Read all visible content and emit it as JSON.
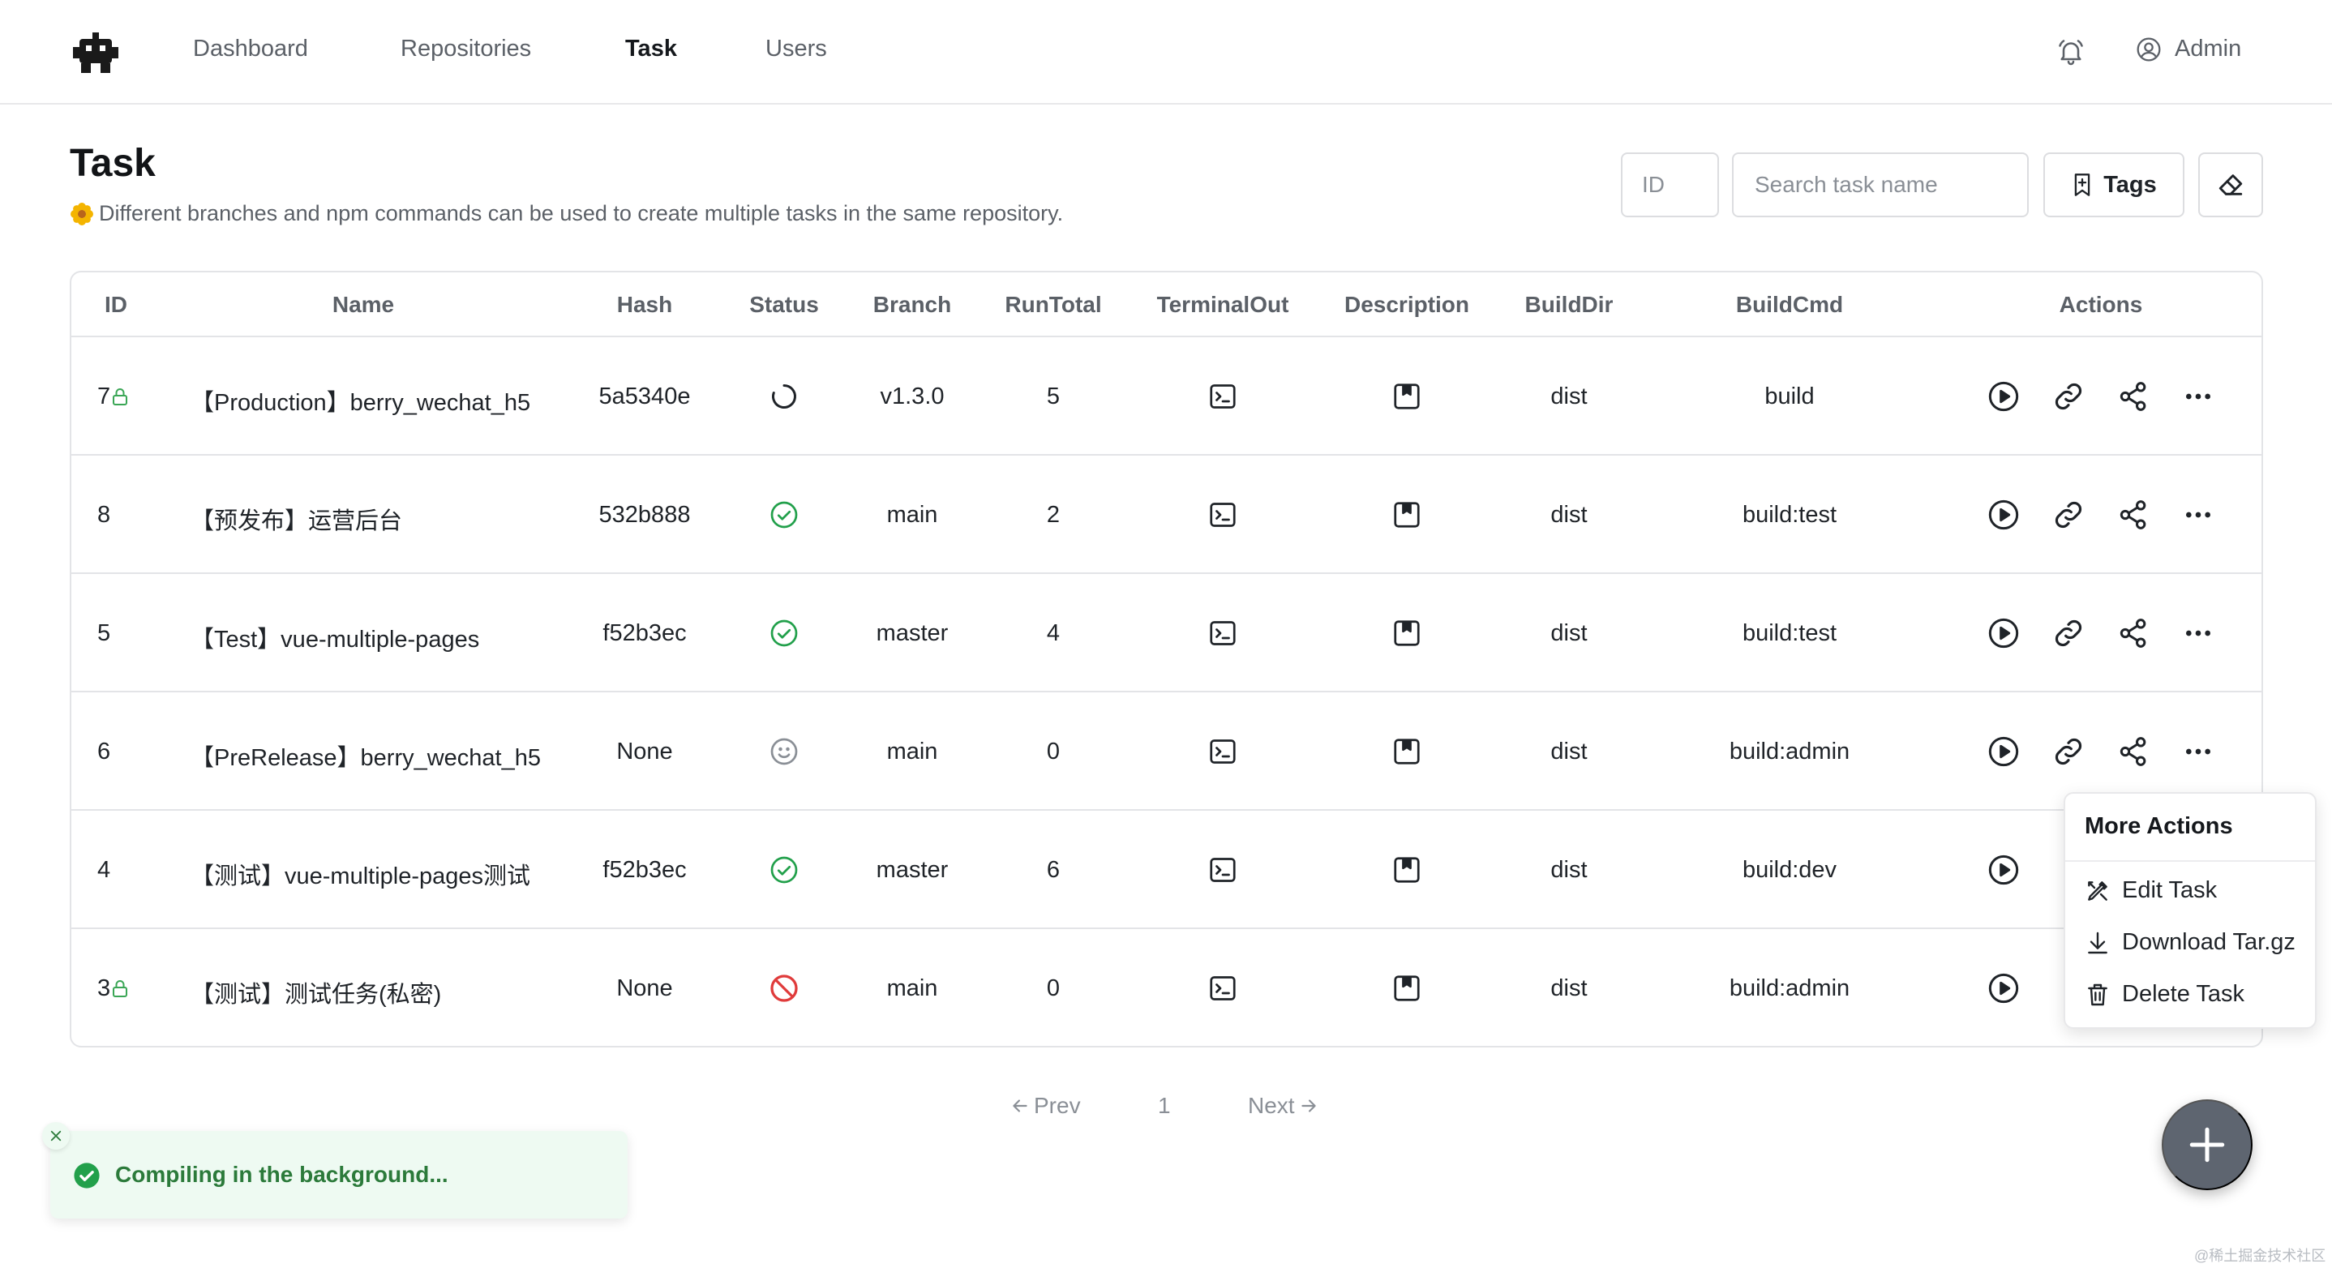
{
  "nav": {
    "items": [
      {
        "label": "Dashboard",
        "active": false
      },
      {
        "label": "Repositories",
        "active": false
      },
      {
        "label": "Task",
        "active": true
      },
      {
        "label": "Users",
        "active": false
      }
    ],
    "user": "Admin"
  },
  "page": {
    "title": "Task",
    "subtitle": "Different branches and npm commands can be used to create multiple tasks in the same repository."
  },
  "filters": {
    "id_placeholder": "ID",
    "name_placeholder": "Search task name",
    "tags_label": "Tags"
  },
  "table": {
    "columns": [
      "ID",
      "Name",
      "Hash",
      "Status",
      "Branch",
      "RunTotal",
      "TerminalOut",
      "Description",
      "BuildDir",
      "BuildCmd",
      "Actions"
    ],
    "rows": [
      {
        "id": "7",
        "locked": true,
        "name": "【Production】berry_wechat_h5",
        "hash": "5a5340e",
        "status": "running",
        "branch": "v1.3.0",
        "run_total": "5",
        "build_dir": "dist",
        "build_cmd": "build"
      },
      {
        "id": "8",
        "locked": false,
        "name": "【预发布】运营后台",
        "hash": "532b888",
        "status": "success",
        "branch": "main",
        "run_total": "2",
        "build_dir": "dist",
        "build_cmd": "build:test"
      },
      {
        "id": "5",
        "locked": false,
        "name": "【Test】vue-multiple-pages",
        "hash": "f52b3ec",
        "status": "success",
        "branch": "master",
        "run_total": "4",
        "build_dir": "dist",
        "build_cmd": "build:test"
      },
      {
        "id": "6",
        "locked": false,
        "name": "【PreRelease】berry_wechat_h5",
        "hash": "None",
        "status": "idle",
        "branch": "main",
        "run_total": "0",
        "build_dir": "dist",
        "build_cmd": "build:admin"
      },
      {
        "id": "4",
        "locked": false,
        "name": "【测试】vue-multiple-pages测试",
        "hash": "f52b3ec",
        "status": "success",
        "branch": "master",
        "run_total": "6",
        "build_dir": "dist",
        "build_cmd": "build:dev"
      },
      {
        "id": "3",
        "locked": true,
        "name": "【测试】测试任务(私密)",
        "hash": "None",
        "status": "failed",
        "branch": "main",
        "run_total": "0",
        "build_dir": "dist",
        "build_cmd": "build:admin"
      }
    ]
  },
  "more_actions": {
    "title": "More Actions",
    "items": [
      "Edit Task",
      "Download Tar.gz",
      "Delete Task"
    ]
  },
  "pagination": {
    "prev": "Prev",
    "current": "1",
    "next": "Next"
  },
  "toast": {
    "message": "Compiling in the background..."
  },
  "watermark": "@稀土掘金技术社区",
  "colors": {
    "success": "#22a04b",
    "failed": "#e03b3b",
    "lock": "#3aa655",
    "fab": "#5e6570",
    "toast_bg": "#eefaf2",
    "toast_text": "#2b7a3a"
  }
}
